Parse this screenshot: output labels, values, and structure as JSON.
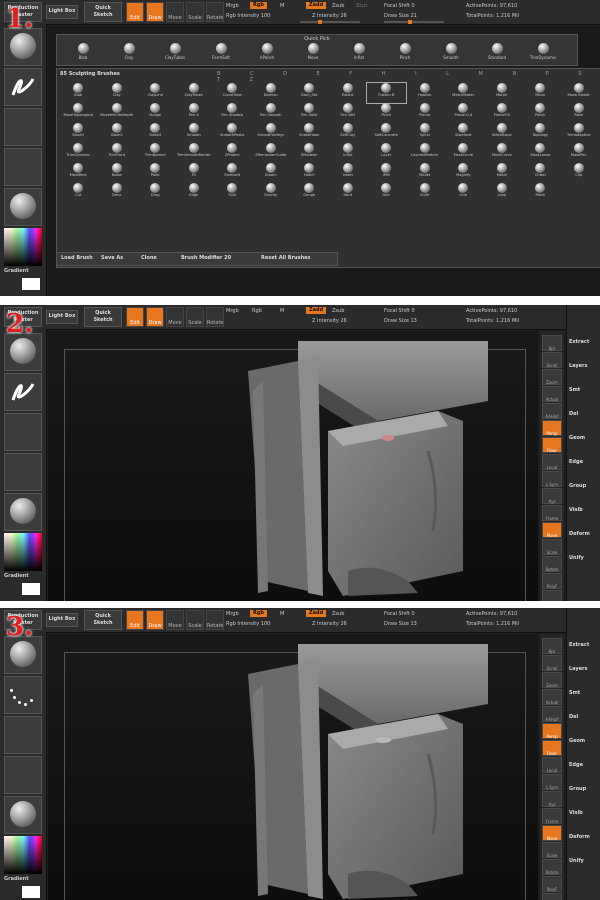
{
  "steps": [
    "1.",
    "2.",
    "3."
  ],
  "topbar": {
    "production_master": "Production Master",
    "lightbox": "Light Box",
    "quick_sketch": "Quick Sketch",
    "tools": [
      "Edit",
      "Draw",
      "Move",
      "Scale",
      "Rotate"
    ],
    "mrgb": "Mrgb",
    "rgb": "Rgb",
    "m": "M",
    "rgb_intensity": "Rgb Intensity 100",
    "zadd": "Zadd",
    "zsub": "Zsub",
    "zcut": "Zcut",
    "z_intensity": "Z Intensity 26",
    "focal_shift": "Focal Shift 0",
    "draw_size_1": "Draw Size 21",
    "draw_size_2": "Draw Size 13",
    "active_points": "ActivePoints: 97,610",
    "total_points": "TotalPoints: 1.216 Mil"
  },
  "tray": {
    "gradient": "Gradient",
    "brush_caption": "Standard",
    "stroke_caption": "Freehand",
    "alpha_caption": "Alpha Off",
    "texture_caption": "Texture Off",
    "material_caption": "MatCap Gray"
  },
  "quick_pick": {
    "title": "Quick Pick",
    "brushes": [
      "Blob",
      "Clay",
      "ClayTubes",
      "FormSoft",
      "hPolish",
      "Move",
      "Inflat",
      "Pinch",
      "Smooth",
      "Standard",
      "TrimDynamic"
    ]
  },
  "brush_palette": {
    "header": "85 Sculpting Brushes",
    "alphabet": "B C D E F H I L M N P S T Z",
    "brushes": [
      "Blob",
      "Clay",
      "ClayLine",
      "ClayTubes",
      "CurveTube",
      "Damian",
      "Dam_Std",
      "Elastic",
      "Flatten B",
      "Hpolish",
      "MatchMaker",
      "Morph",
      "Move",
      "Move Elastic",
      "MoveTopological",
      "MoveInfiniteDepth",
      "Nudge",
      "Pen A",
      "Pen Shadow",
      "Pen Smooth",
      "Pen Solid",
      "Pen Wet",
      "Pinch",
      "Planar",
      "PlanarCut",
      "PlanarFill",
      "Polish",
      "Rake",
      "Slash1",
      "Slash2",
      "Slash3",
      "Smooth",
      "SmoothPeaks",
      "SmoothValleys",
      "SnakeHook",
      "SoftClay",
      "SoftConcrete",
      "Spiral",
      "Standard",
      "StitchBasic",
      "Topology",
      "TrimAdaptive",
      "TrimDynamic",
      "TrimFront",
      "TrimNormal",
      "TrimSmoothBorder",
      "ZProject",
      "ZRemesherGuide",
      "ZModeler",
      "Inflat",
      "Layer",
      "LayeredPattern",
      "MaskCircle",
      "MaskCurve",
      "MaskLasso",
      "MaskPen",
      "MaskRect",
      "Noise",
      "Paint",
      "Fit",
      "Formsoft",
      "Groom",
      "Hatch",
      "Insert",
      "IMM",
      "Mallet",
      "Magnify",
      "Metal",
      "Chisel",
      "Clip",
      "Cut",
      "Deco",
      "Drag",
      "Edge",
      "Fold",
      "Gravity",
      "Gouge",
      "Hard",
      "Hair",
      "Knife",
      "Line",
      "Loop",
      "Mesh"
    ],
    "selected_label": "Flatten",
    "load_brush": "Load Brush",
    "save_as": "Save As",
    "clone": "Clone",
    "brush_modifier": "Brush Modifier 20",
    "reset_all": "Reset All Brushes"
  },
  "shelf": {
    "buttons": [
      "Bpr",
      "Scroll",
      "Zoom",
      "Actual",
      "AAHalf",
      "Persp",
      "Floor",
      "Local",
      "L.Sym",
      "Xyz",
      "Frame",
      "Move",
      "Scale",
      "Rotate",
      "PolyF",
      "Transp"
    ],
    "right_panel": [
      "Extract",
      "Layers",
      "Smt",
      "Del",
      "Geom",
      "Edge",
      "Group",
      "Visib",
      "Deform",
      "Unify"
    ]
  },
  "colors": {
    "accent": "#e8761e",
    "background": "#1e1e1e",
    "step_number": "#e02020"
  }
}
